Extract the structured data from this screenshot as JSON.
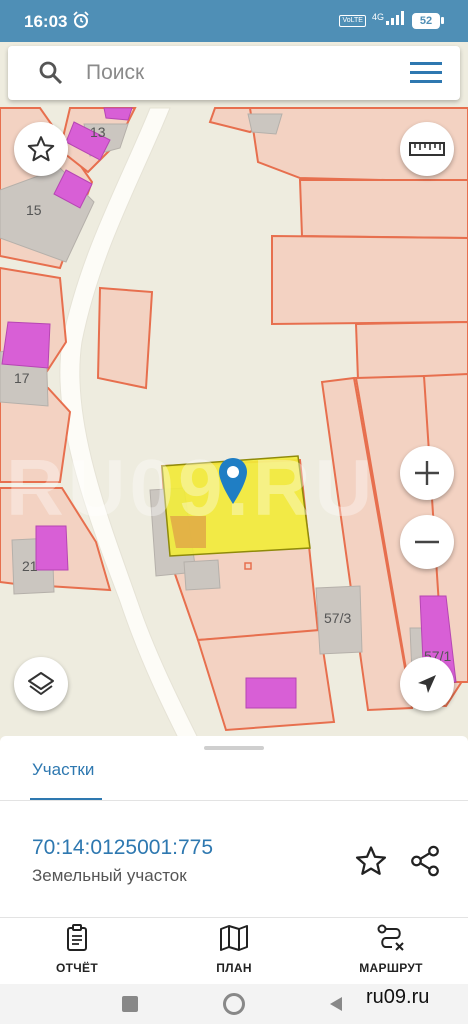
{
  "status_bar": {
    "time": "16:03",
    "network": "4G",
    "volte": "VoLTE",
    "battery": "52"
  },
  "search": {
    "placeholder": "Поиск"
  },
  "map": {
    "labels": {
      "house_13": "13",
      "house_15": "15",
      "house_17": "17",
      "house_21": "21",
      "house_57_3": "57/3",
      "house_57_1": "57/1"
    },
    "watermark": "RU09.RU",
    "colors": {
      "background": "#eeecdf",
      "parcel_fill": "#f3d2c2",
      "parcel_border": "#e76f4e",
      "building": "#cbc6c0",
      "building_highlight": "#d85fd6",
      "selected_parcel": "#f2ec38",
      "marker": "#1f7ec4"
    }
  },
  "sheet": {
    "tab_label": "Участки",
    "parcel": {
      "cadastral_number": "70:14:0125001:775",
      "type": "Земельный участок"
    },
    "actions": [
      {
        "label": "ОТЧЁТ",
        "icon": "report-icon"
      },
      {
        "label": "ПЛАН",
        "icon": "map-plan-icon"
      },
      {
        "label": "МАРШРУТ",
        "icon": "route-icon"
      }
    ]
  },
  "watermark_text": "ru09.ru",
  "accent_color": "#2e78b0",
  "status_bar_color": "#4f8fb6"
}
